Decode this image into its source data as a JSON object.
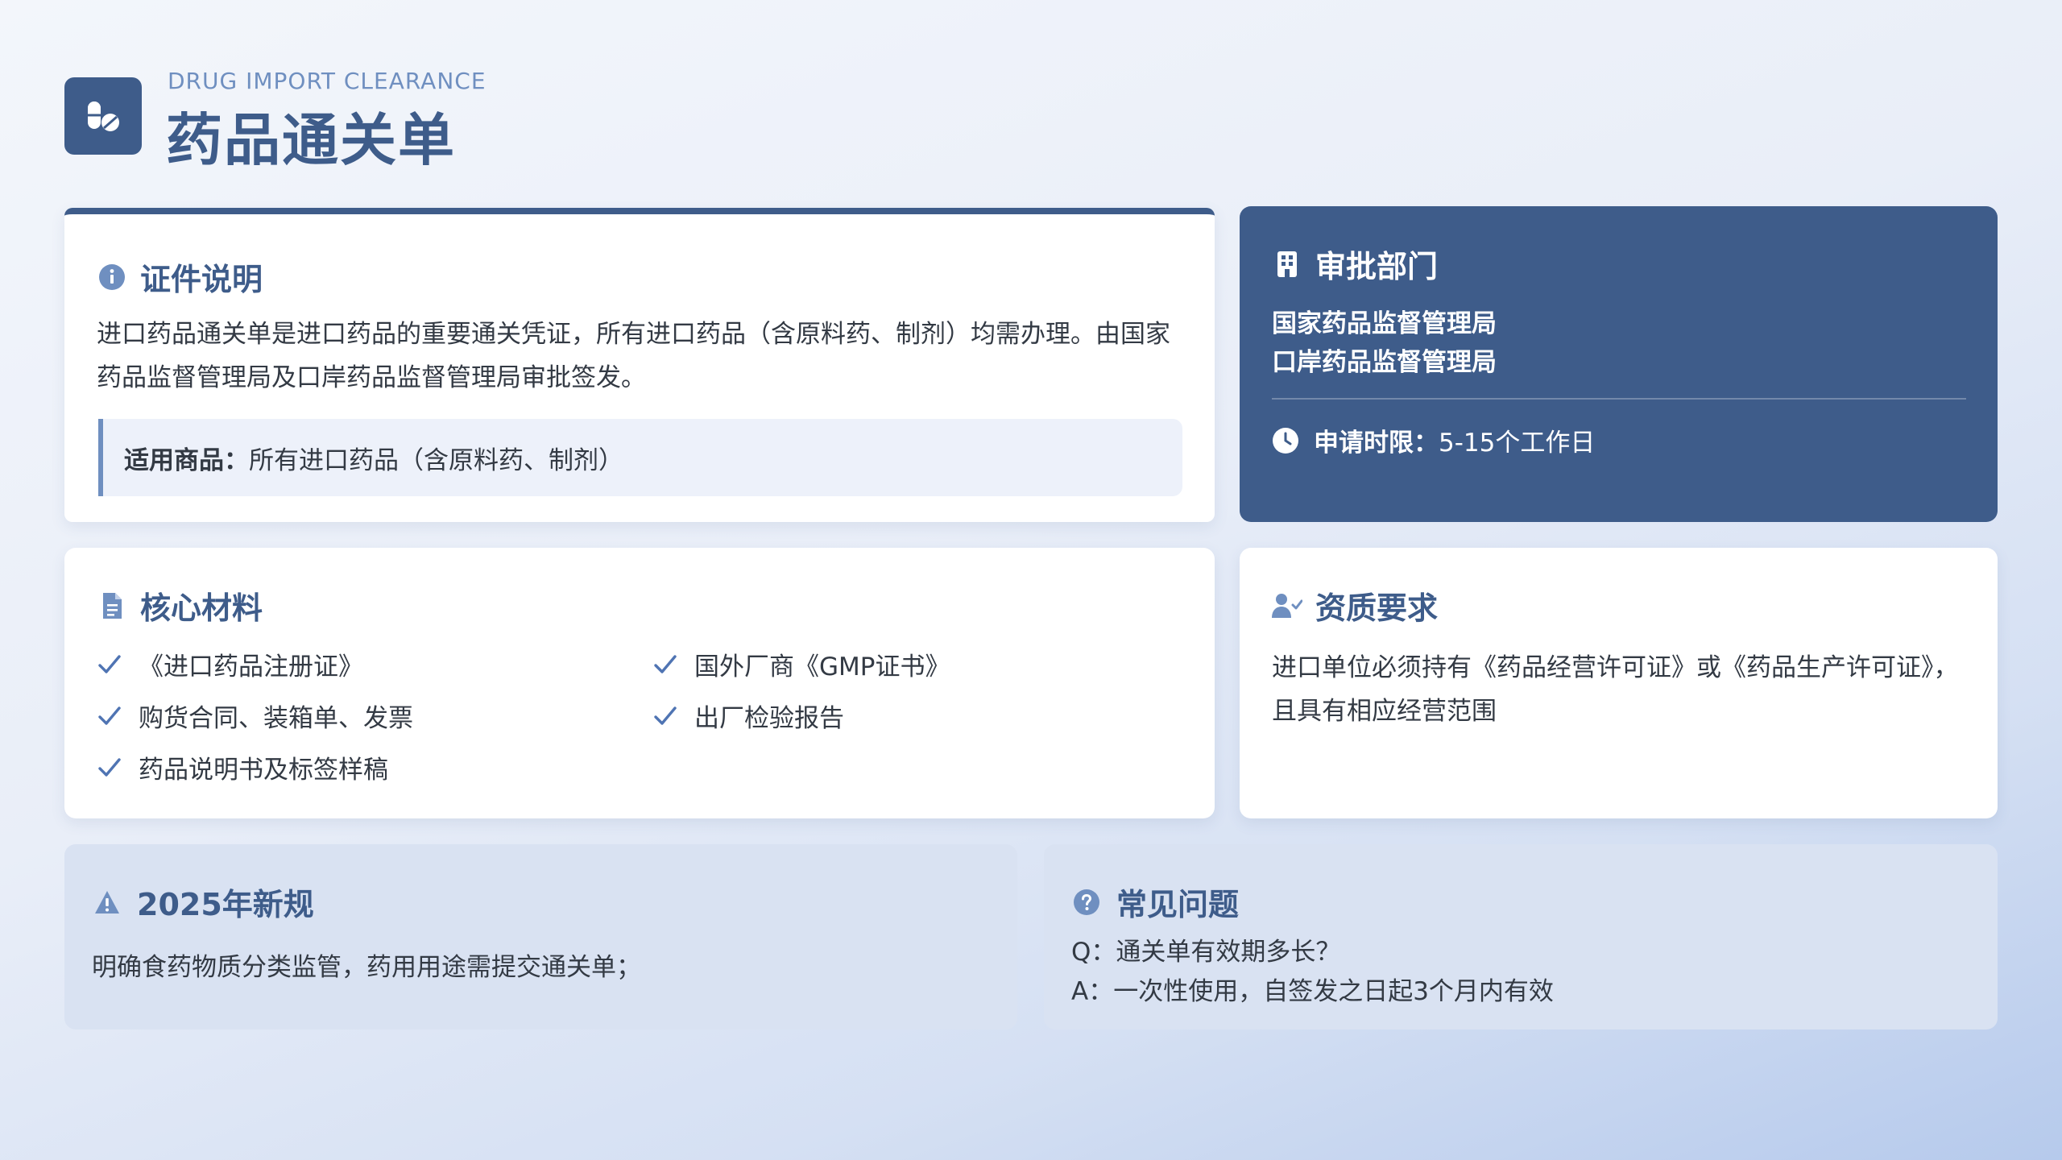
{
  "header": {
    "subtitle": "DRUG IMPORT CLEARANCE",
    "title": "药品通关单",
    "logo_icon": "pills-icon"
  },
  "certificate": {
    "title": "证件说明",
    "icon": "info-circle-icon",
    "description": "进口药品通关单是进口药品的重要通关凭证，所有进口药品（含原料药、制剂）均需办理。由国家药品监督管理局及口岸药品监督管理局审批签发。",
    "goods_label": "适用商品：",
    "goods_value": "所有进口药品（含原料药、制剂）"
  },
  "approval": {
    "title": "审批部门",
    "icon": "building-icon",
    "departments": [
      "国家药品监督管理局",
      "口岸药品监督管理局"
    ],
    "time_icon": "clock-icon",
    "time_label": "申请时限：",
    "time_value": "5-15个工作日"
  },
  "materials": {
    "title": "核心材料",
    "icon": "document-icon",
    "items": [
      "《进口药品注册证》",
      "国外厂商《GMP证书》",
      "购货合同、装箱单、发票",
      "出厂检验报告",
      "药品说明书及标签样稿"
    ]
  },
  "qualification": {
    "title": "资质要求",
    "icon": "user-check-icon",
    "text": "进口单位必须持有《药品经营许可证》或《药品生产许可证》，且具有相应经营范围"
  },
  "new_rules": {
    "title": "2025年新规",
    "icon": "warning-icon",
    "text": "明确食药物质分类监管，药用用途需提交通关单；"
  },
  "faq": {
    "title": "常见问题",
    "icon": "question-circle-icon",
    "question": "Q：通关单有效期多长？",
    "answer": "A：一次性使用，自签发之日起3个月内有效"
  },
  "colors": {
    "primary": "#3e5c8a",
    "accent": "#6f8fc0",
    "card": "#ffffff",
    "soft_card": "#d9e2f2"
  }
}
